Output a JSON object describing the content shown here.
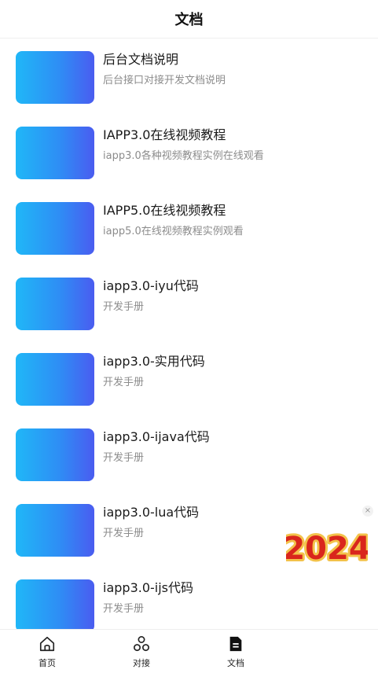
{
  "header": {
    "title": "文档"
  },
  "documents": [
    {
      "title": "后台文档说明",
      "subtitle": "后台接口对接开发文档说明"
    },
    {
      "title": "IAPP3.0在线视频教程",
      "subtitle": "iapp3.0各种视频教程实例在线观看"
    },
    {
      "title": "IAPP5.0在线视频教程",
      "subtitle": "iapp5.0在线视频教程实例观看"
    },
    {
      "title": "iapp3.0-iyu代码",
      "subtitle": "开发手册"
    },
    {
      "title": "iapp3.0-实用代码",
      "subtitle": "开发手册"
    },
    {
      "title": "iapp3.0-ijava代码",
      "subtitle": "开发手册"
    },
    {
      "title": "iapp3.0-lua代码",
      "subtitle": "开发手册"
    },
    {
      "title": "iapp3.0-ijs代码",
      "subtitle": "开发手册"
    }
  ],
  "floating_ad": {
    "text": "2024",
    "close_label": "×"
  },
  "tabbar": {
    "items": [
      {
        "label": "首页",
        "icon": "home-icon"
      },
      {
        "label": "对接",
        "icon": "connect-icon"
      },
      {
        "label": "文档",
        "icon": "document-icon"
      }
    ]
  },
  "colors": {
    "thumb_start": "#20b7f7",
    "thumb_end": "#4a5cf0",
    "ad_red": "#d9261c",
    "ad_gold": "#f3c24a"
  }
}
